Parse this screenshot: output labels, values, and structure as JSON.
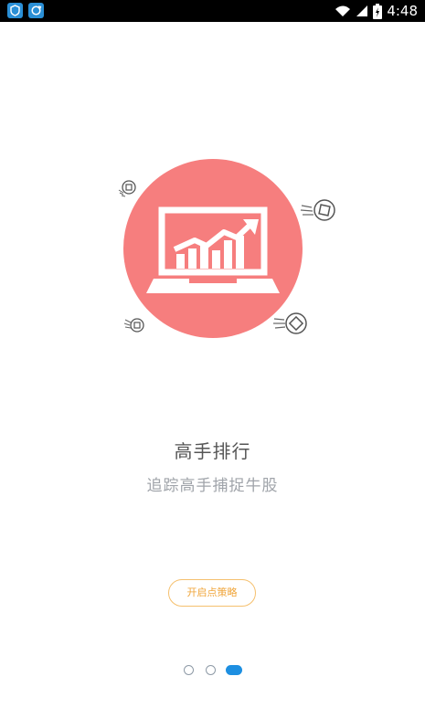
{
  "status_bar": {
    "time": "4:48",
    "icons": [
      "shield-app-icon",
      "sync-app-icon",
      "wifi-icon",
      "signal-icon",
      "battery-icon"
    ]
  },
  "guide": {
    "title": "高手排行",
    "subtitle": "追踪高手捕捉牛股",
    "start_button_label": "开启点策略",
    "illustration": "laptop-chart-icon",
    "page_indicator": {
      "total": 3,
      "current": 3
    }
  },
  "colors": {
    "accent_circle": "#f67e7e",
    "button_text": "#f0a53a",
    "button_border": "#f5c06e",
    "indicator_active": "#1d8fe1"
  }
}
